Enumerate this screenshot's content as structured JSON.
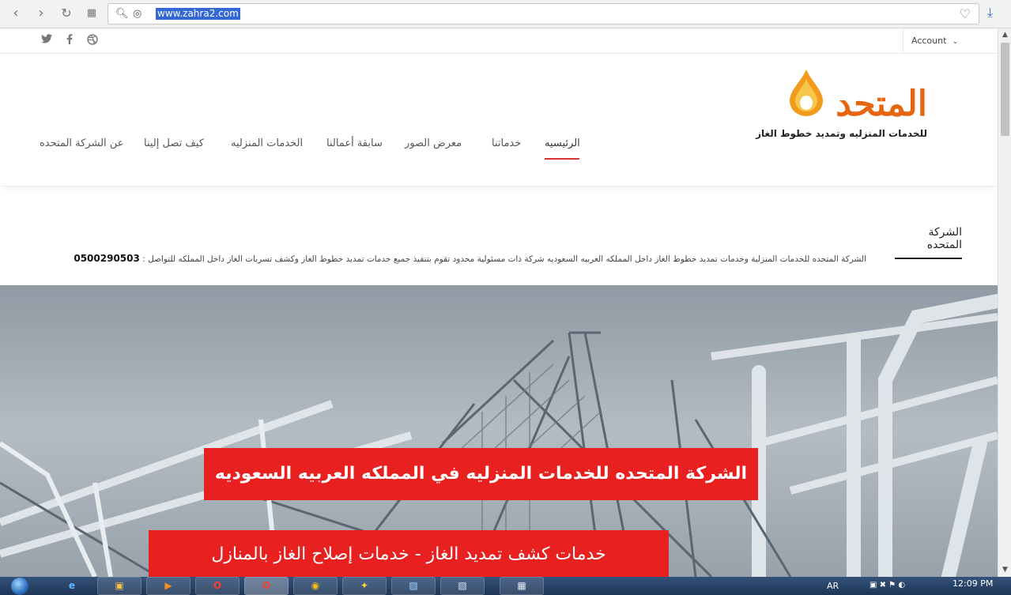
{
  "browser": {
    "url": "www.zahra2.com"
  },
  "topbar": {
    "account_label": "Account",
    "social_icons": [
      "twitter-icon",
      "facebook-icon",
      "dribbble-icon"
    ]
  },
  "logo": {
    "title": "المتحد",
    "tagline": "للخدمات المنزليه وتمديد خطوط الغاز"
  },
  "menu": {
    "items": [
      {
        "label": "الرئيسيه",
        "active": true
      },
      {
        "label": "خدماتنا"
      },
      {
        "label": "معرض الصور"
      },
      {
        "label": "سابقة أعمالنا"
      },
      {
        "label": "الخدمات المنزليه"
      },
      {
        "label": "كيف تصل إلينا"
      },
      {
        "label": "عن الشركة المتحده"
      }
    ]
  },
  "about": {
    "title": "الشركة المتحده",
    "text": "الشركة المتحده للخدمات المنزلية وخدمات تمديد خطوط الغاز داخل المملكه العربيه السعوديه شركة ذات مسئولية محدود تقوم بتنفيذ جميع خدمات تمديد خطوط الغاز وكشف تسربات الغاز داخل المملكه للتواصل :",
    "phone": "0500290503"
  },
  "hero": {
    "banner1": "الشركة المتحده للخدمات المنزليه في المملكه العربيه السعوديه",
    "banner2": "خدمات كشف تمديد الغاز - خدمات إصلاح الغاز بالمنازل"
  },
  "taskbar": {
    "language": "AR",
    "time": "12:09 PM"
  },
  "colors": {
    "accent_red": "#e8201f",
    "logo_orange": "#e8650f",
    "menu_underline": "#dd3333"
  }
}
